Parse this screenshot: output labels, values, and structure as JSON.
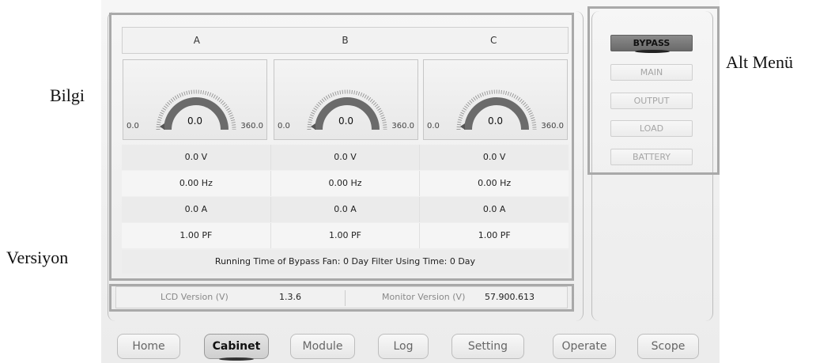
{
  "annotations": {
    "info": "Bilgi",
    "sub_menu": "Alt Menü",
    "version": "Versiyon"
  },
  "phases": [
    "A",
    "B",
    "C"
  ],
  "gauges": [
    {
      "value": "0.0",
      "min": "0.0",
      "max": "360.0"
    },
    {
      "value": "0.0",
      "min": "0.0",
      "max": "360.0"
    },
    {
      "value": "0.0",
      "min": "0.0",
      "max": "360.0"
    }
  ],
  "rows": [
    [
      "0.0  V",
      "0.0  V",
      "0.0  V"
    ],
    [
      "0.00  Hz",
      "0.00  Hz",
      "0.00  Hz"
    ],
    [
      "0.0  A",
      "0.0  A",
      "0.0  A"
    ],
    [
      "1.00  PF",
      "1.00  PF",
      "1.00  PF"
    ]
  ],
  "fan_text": "Running Time of Bypass Fan:  0  Day   Filter Using Time:  0  Day",
  "version_bar": {
    "lcd_label": "LCD Version (V)",
    "lcd_value": "1.3.6",
    "monitor_label": "Monitor Version (V)",
    "monitor_value": "57.900.613"
  },
  "sub_menu": {
    "items": [
      "BYPASS",
      "MAIN",
      "OUTPUT",
      "LOAD",
      "BATTERY"
    ],
    "active": "BYPASS"
  },
  "tabs": {
    "items": [
      "Home",
      "Cabinet",
      "Module",
      "Log",
      "Setting",
      "Operate",
      "Scope"
    ],
    "active": "Cabinet"
  },
  "colors": {
    "highlight_border": "#a9a9a9",
    "active_menu_bg": "#7a7a7a",
    "gauge_arc": "#6b6b6b"
  }
}
